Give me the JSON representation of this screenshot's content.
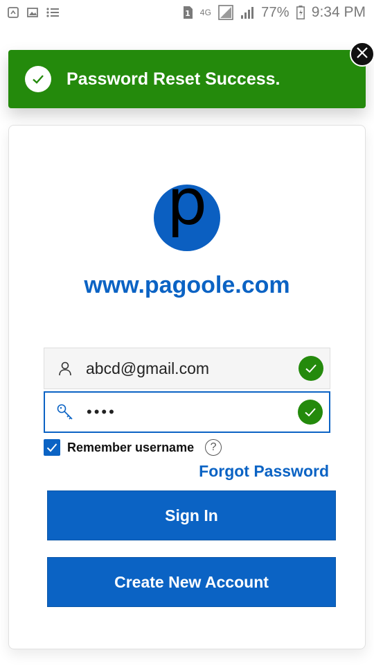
{
  "status_bar": {
    "network": "4G",
    "battery": "77%",
    "time": "9:34 PM",
    "sim_badge": "1",
    "icons": [
      "screenshot-icon",
      "gallery-icon",
      "list-icon",
      "sim-icon",
      "data-icon",
      "signal-icon",
      "battery-icon"
    ]
  },
  "toast": {
    "message": "Password Reset Success.",
    "color": "#248a0c"
  },
  "logo": {
    "letter": "p",
    "color": "#0b5fc1"
  },
  "site_title": "www.pagoole.com",
  "form": {
    "username_value": "abcd@gmail.com",
    "password_display": "••••",
    "remember_label": "Remember username",
    "remember_checked": true,
    "help_glyph": "?",
    "forgot_label": "Forgot Password"
  },
  "buttons": {
    "signin_label": "Sign In",
    "create_label": "Create New Account"
  },
  "colors": {
    "accent": "#0b63c4",
    "success": "#248a0c"
  }
}
